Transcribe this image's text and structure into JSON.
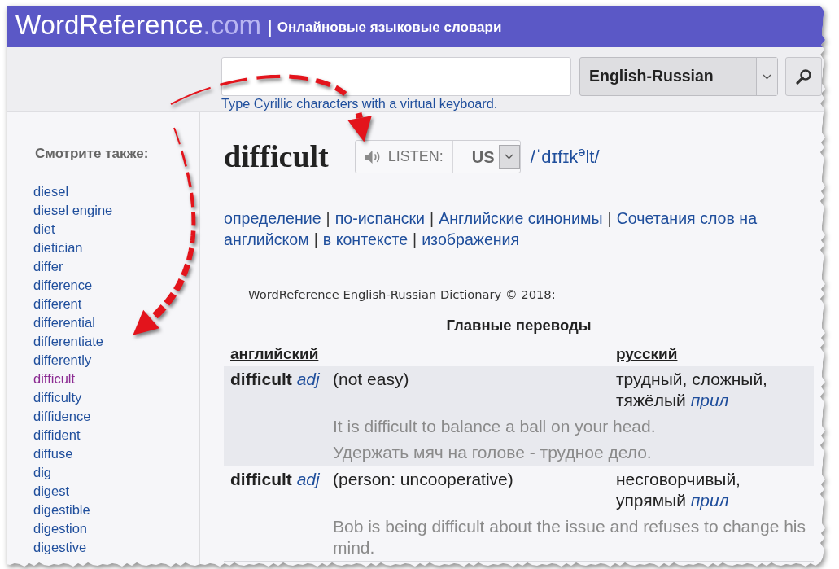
{
  "header": {
    "logo": {
      "name": "WordReference",
      "suffix": ".com"
    },
    "separator": "|",
    "tagline": "Онлайновые языковые словари"
  },
  "search": {
    "dictionary": "English-Russian",
    "hint": "Type Cyrillic characters with a virtual keyboard."
  },
  "sidebar": {
    "title": "Смотрите также:",
    "items": [
      {
        "label": "diesel",
        "selected": false
      },
      {
        "label": "diesel engine",
        "selected": false
      },
      {
        "label": "diet",
        "selected": false
      },
      {
        "label": "dietician",
        "selected": false
      },
      {
        "label": "differ",
        "selected": false
      },
      {
        "label": "difference",
        "selected": false
      },
      {
        "label": "different",
        "selected": false
      },
      {
        "label": "differential",
        "selected": false
      },
      {
        "label": "differentiate",
        "selected": false
      },
      {
        "label": "differently",
        "selected": false
      },
      {
        "label": "difficult",
        "selected": true
      },
      {
        "label": "difficulty",
        "selected": false
      },
      {
        "label": "diffidence",
        "selected": false
      },
      {
        "label": "diffident",
        "selected": false
      },
      {
        "label": "diffuse",
        "selected": false
      },
      {
        "label": "dig",
        "selected": false
      },
      {
        "label": "digest",
        "selected": false
      },
      {
        "label": "digestible",
        "selected": false
      },
      {
        "label": "digestion",
        "selected": false
      },
      {
        "label": "digestive",
        "selected": false
      }
    ]
  },
  "entry": {
    "headword": "difficult",
    "listen": {
      "label": "LISTEN:",
      "accent": "US"
    },
    "pronunciation": "/ˈdɪfɪk$^{ə}$lt/"
  },
  "links": [
    {
      "kind": "link",
      "text": "определение"
    },
    {
      "kind": "separator",
      "text": "|"
    },
    {
      "kind": "link",
      "text": "по-испански"
    },
    {
      "kind": "separator",
      "text": "|"
    },
    {
      "kind": "link",
      "text": "Английские синонимы"
    },
    {
      "kind": "separator",
      "text": "|"
    },
    {
      "kind": "link",
      "text": "Сочетания слов на"
    },
    {
      "kind": "link",
      "text": "английском"
    },
    {
      "kind": "separator",
      "text": "|"
    },
    {
      "kind": "link",
      "text": "в контексте"
    },
    {
      "kind": "separator",
      "text": "|"
    },
    {
      "kind": "link",
      "text": "изображения"
    }
  ],
  "dictionary": {
    "title": "WordReference English-Russian Dictionary © 2018:",
    "section": "Главные переводы",
    "columns": [
      "английский",
      "русский"
    ],
    "rows": [
      {
        "term": "difficult",
        "pos": "adj",
        "sense": "(not easy)",
        "translation": "трудный, сложный, тяжёлый",
        "translation_pos": "прил",
        "examples": [
          "It is difficult to balance a ball on your head.",
          "Удержать мяч на голове - трудное дело."
        ]
      },
      {
        "term": "difficult",
        "pos": "adj",
        "sense": "(person: uncooperative)",
        "translation": "несговорчивый, упрямый",
        "translation_pos": "прил",
        "examples": [
          "Bob is being difficult about the issue and refuses to change his mind."
        ]
      }
    ]
  }
}
